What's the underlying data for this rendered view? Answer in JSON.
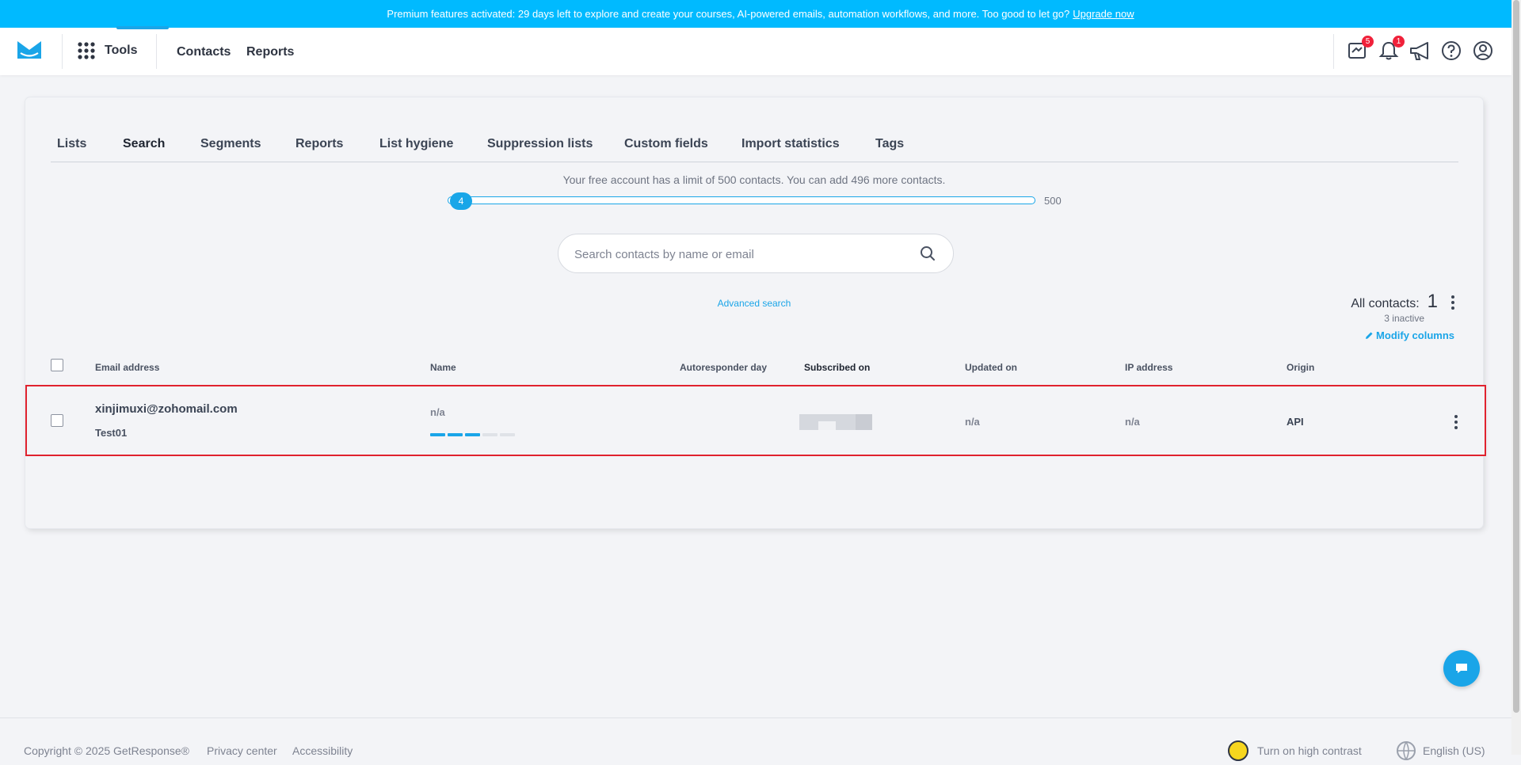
{
  "banner": {
    "text": "Premium features activated: 29 days left to explore and create your courses, AI-powered emails, automation workflows, and more. Too good to let go?",
    "link": "Upgrade now"
  },
  "topnav": {
    "tools_label": "Tools",
    "links": [
      "Contacts",
      "Reports"
    ],
    "badges": {
      "editor": "5",
      "notifications": "1"
    }
  },
  "tabs": [
    "Lists",
    "Search",
    "Segments",
    "Reports",
    "List hygiene",
    "Suppression lists",
    "Custom fields",
    "Import statistics",
    "Tags"
  ],
  "limit": {
    "text": "Your free account has a limit of 500 contacts. You can add 496 more contacts.",
    "current": "4",
    "max": "500",
    "fraction": 0.008
  },
  "search": {
    "placeholder": "Search contacts by name or email"
  },
  "advanced_search": "Advanced search",
  "summary": {
    "all_label": "All contacts:",
    "count": "1",
    "inactive": "3 inactive",
    "modify_columns": "Modify columns"
  },
  "table": {
    "columns": [
      "Email address",
      "Name",
      "Autoresponder day",
      "Subscribed on",
      "Updated on",
      "IP address",
      "Origin"
    ],
    "rows": [
      {
        "email": "xinjimuxi@zohomail.com",
        "contact_name": "Test01",
        "name": "n/a",
        "engagement_score": 3,
        "engagement_max": 5,
        "autoresponder_day": "",
        "updated_on": "n/a",
        "ip_address": "n/a",
        "origin": "API"
      }
    ]
  },
  "footer": {
    "copyright": "Copyright © 2025 GetResponse®",
    "privacy": "Privacy center",
    "accessibility": "Accessibility",
    "high_contrast": "Turn on high contrast",
    "language": "English (US)"
  },
  "colors": {
    "banner": "#00baff",
    "accent": "#1aa5e8",
    "row_highlight": "#e0222e",
    "badge": "#f0213a",
    "score_on": "#1aa5e8",
    "score_off": "#dfe2e7"
  }
}
